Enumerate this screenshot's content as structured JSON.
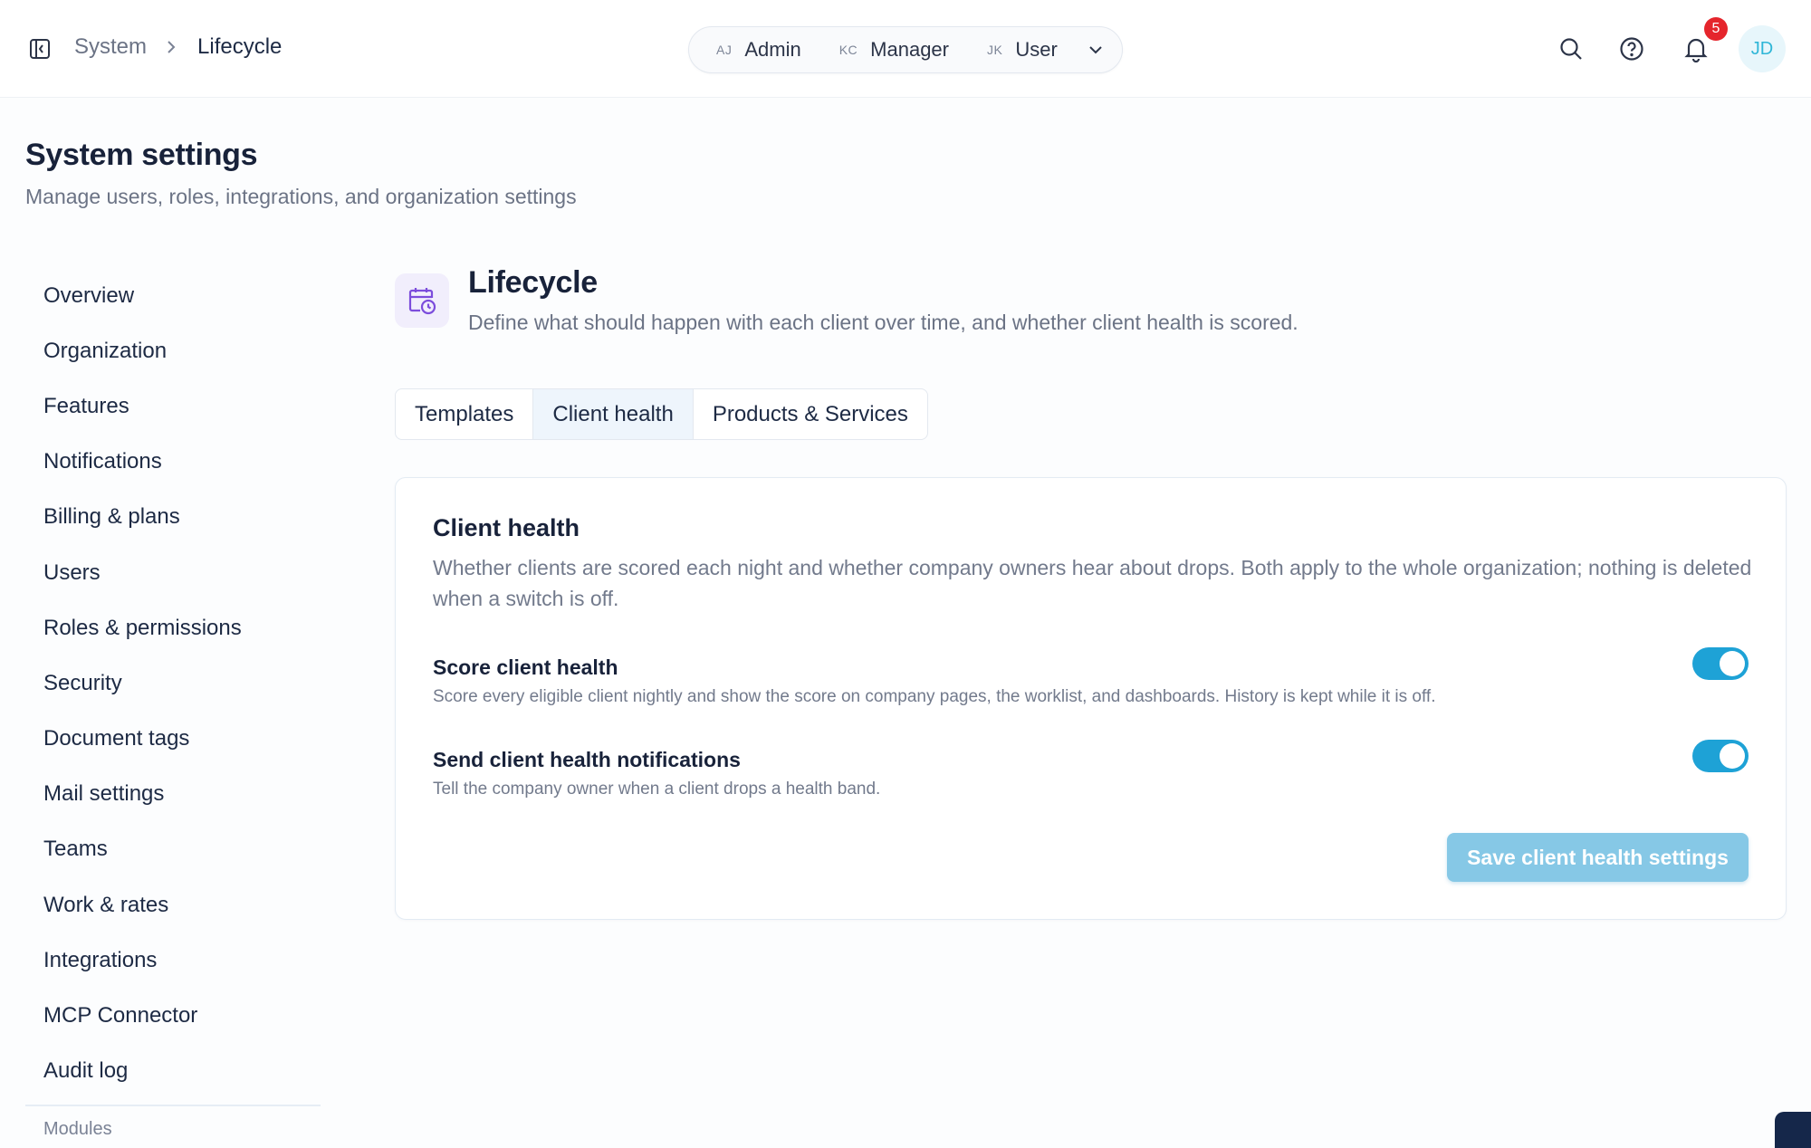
{
  "header": {
    "breadcrumb": {
      "root": "System",
      "current": "Lifecycle"
    },
    "role_switch": {
      "roles": [
        {
          "initials": "AJ",
          "label": "Admin"
        },
        {
          "initials": "KC",
          "label": "Manager"
        },
        {
          "initials": "JK",
          "label": "User"
        }
      ]
    },
    "notifications_count": "5",
    "avatar_initials": "JD"
  },
  "page": {
    "title": "System settings",
    "subtitle": "Manage users, roles, integrations, and organization settings"
  },
  "sidebar": {
    "items": [
      {
        "label": "Overview"
      },
      {
        "label": "Organization"
      },
      {
        "label": "Features"
      },
      {
        "label": "Notifications"
      },
      {
        "label": "Billing & plans"
      },
      {
        "label": "Users"
      },
      {
        "label": "Roles & permissions"
      },
      {
        "label": "Security"
      },
      {
        "label": "Document tags"
      },
      {
        "label": "Mail settings"
      },
      {
        "label": "Teams"
      },
      {
        "label": "Work & rates"
      },
      {
        "label": "Integrations"
      },
      {
        "label": "MCP Connector"
      },
      {
        "label": "Audit log"
      }
    ],
    "section_label": "Modules"
  },
  "section": {
    "title": "Lifecycle",
    "description": "Define what should happen with each client over time, and whether client health is scored.",
    "tabs": [
      {
        "label": "Templates"
      },
      {
        "label": "Client health"
      },
      {
        "label": "Products & Services"
      }
    ],
    "active_tab": "Client health"
  },
  "card": {
    "title": "Client health",
    "description": "Whether clients are scored each night and whether company owners hear about drops. Both apply to the whole organization; nothing is deleted when a switch is off.",
    "settings": [
      {
        "title": "Score client health",
        "description": "Score every eligible client nightly and show the score on company pages, the worklist, and dashboards. History is kept while it is off.",
        "enabled": true
      },
      {
        "title": "Send client health notifications",
        "description": "Tell the company owner when a client drops a health band.",
        "enabled": true
      }
    ],
    "save_label": "Save client health settings"
  },
  "colors": {
    "accent": "#1ea2d6",
    "save_button_disabled": "#86c8e6",
    "badge": "#e5252c",
    "section_icon": "#7c4ddc"
  }
}
